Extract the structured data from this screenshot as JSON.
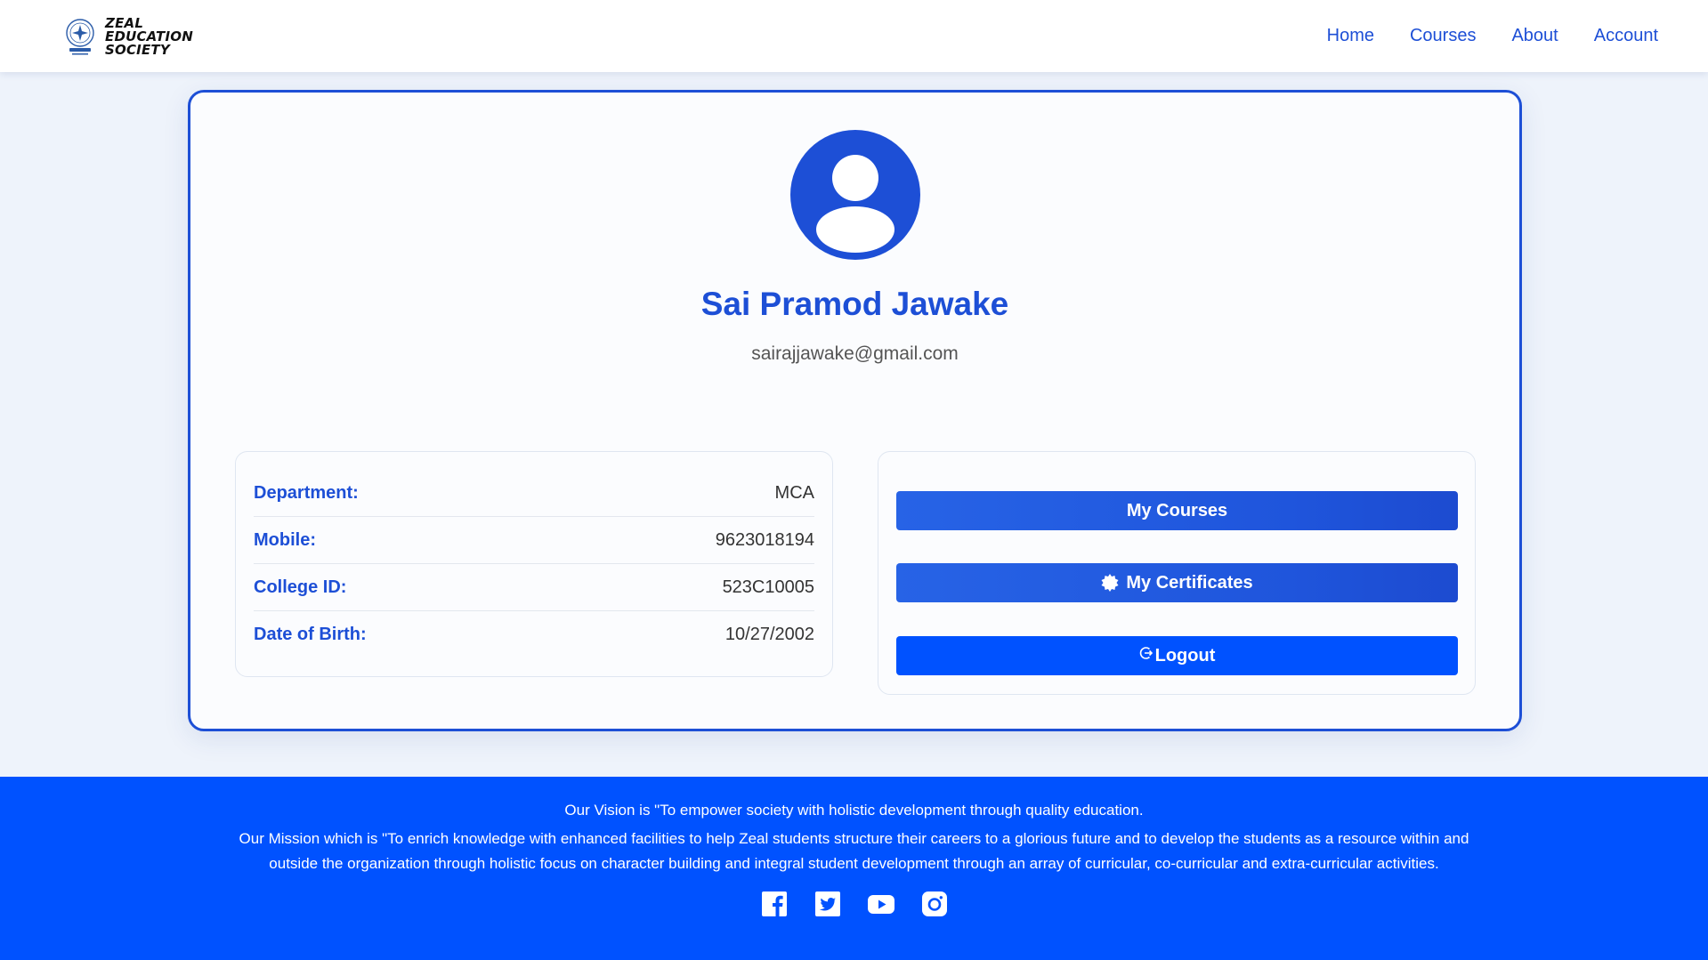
{
  "brand": {
    "lines": [
      "ZEAL",
      "EDUCATION",
      "SOCIETY"
    ],
    "seal_icon": "zeal-seal-logo"
  },
  "nav": {
    "items": [
      {
        "label": "Home"
      },
      {
        "label": "Courses"
      },
      {
        "label": "About"
      },
      {
        "label": "Account"
      }
    ]
  },
  "profile": {
    "avatar_icon": "user-avatar-icon",
    "name": "Sai Pramod Jawake",
    "email": "sairajjawake@gmail.com"
  },
  "details": [
    {
      "label": "Department:",
      "value": "MCA"
    },
    {
      "label": "Mobile:",
      "value": "9623018194"
    },
    {
      "label": "College ID:",
      "value": "523C10005"
    },
    {
      "label": "Date of Birth:",
      "value": "10/27/2002"
    }
  ],
  "actions": {
    "my_courses": "My Courses",
    "my_certificates": "My Certificates",
    "logout": "Logout"
  },
  "footer": {
    "vision": "Our Vision is \"To empower society with holistic development through quality education.",
    "mission": "Our Mission which is \"To enrich knowledge with enhanced facilities to help Zeal students structure their careers to a glorious future and to develop the students as a resource within and outside the organization through holistic focus on character building and integral student development through an array of curricular, co-curricular and extra-curricular activities.",
    "socials": [
      "facebook-icon",
      "twitter-icon",
      "youtube-icon",
      "instagram-icon"
    ]
  },
  "colors": {
    "primary": "#1d4fd6",
    "footer": "#0052ff",
    "background": "#eef3fb"
  }
}
